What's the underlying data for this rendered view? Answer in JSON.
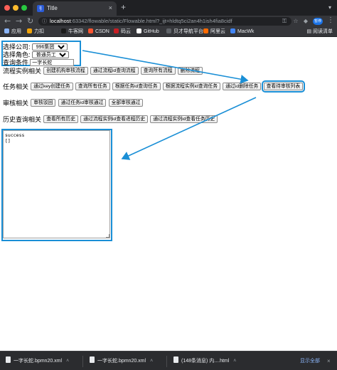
{
  "browser": {
    "tab_title": "Title",
    "tab_close": "×",
    "new_tab": "+",
    "url_host": "localhost",
    "url_rest": ":63342/flowable/static/Flowable.html?_ijt=hldtq5ci2an4h1ish4fia8cidf",
    "profile_label": "暂停",
    "bookmarks": [
      {
        "label": "应用",
        "color": "#8ab4f8"
      },
      {
        "label": "力扣",
        "color": "#f0a30a"
      },
      {
        "label": "牛客网",
        "color": "#1a1a1a"
      },
      {
        "label": "CSDN",
        "color": "#fc5531"
      },
      {
        "label": "码云",
        "color": "#c71d23"
      },
      {
        "label": "GitHub",
        "color": "#ffffff"
      },
      {
        "label": "贝才导航平台",
        "color": "#5f6368"
      },
      {
        "label": "阿里云",
        "color": "#ff6a00"
      },
      {
        "label": "MacWk",
        "color": "#4285f4"
      }
    ],
    "reading_list": "阅读清单"
  },
  "form": {
    "company_label": "选择公司:",
    "company_value": "996集团",
    "role_label": "选择角色:",
    "role_value": "普通员工",
    "query_label": "查询条件",
    "query_value": "一字长蛇"
  },
  "sections": {
    "process": {
      "label": "流程实例相关",
      "buttons": [
        "创建机构审核流程",
        "通过流程id查询流程",
        "查询所有流程",
        "删除流程"
      ]
    },
    "task": {
      "label": "任务相关",
      "buttons": [
        "通过key创建任务",
        "查询所有任务",
        "根据任务id查询任务",
        "根据流程实例id查询任务",
        "通过id删除任务",
        "查看待审核列表"
      ]
    },
    "review": {
      "label": "审核相关",
      "buttons": [
        "审核驳回",
        "通过任务id审核通过",
        "全部审核通过"
      ]
    },
    "history": {
      "label": "历史查询相关",
      "buttons": [
        "查看所有历史",
        "通过流程实例id查看进程历史",
        "通过流程实例id查看任务历史"
      ]
    }
  },
  "result": {
    "text": "success\n[]"
  },
  "downloads": {
    "items": [
      "一字长蛇.bpmn20.xml",
      "一字长蛇.bpmn20.xml",
      "(148条消息) 内....html"
    ],
    "show_all": "显示全部",
    "close": "×"
  },
  "colors": {
    "annotation_blue": "#1a8fd6"
  }
}
